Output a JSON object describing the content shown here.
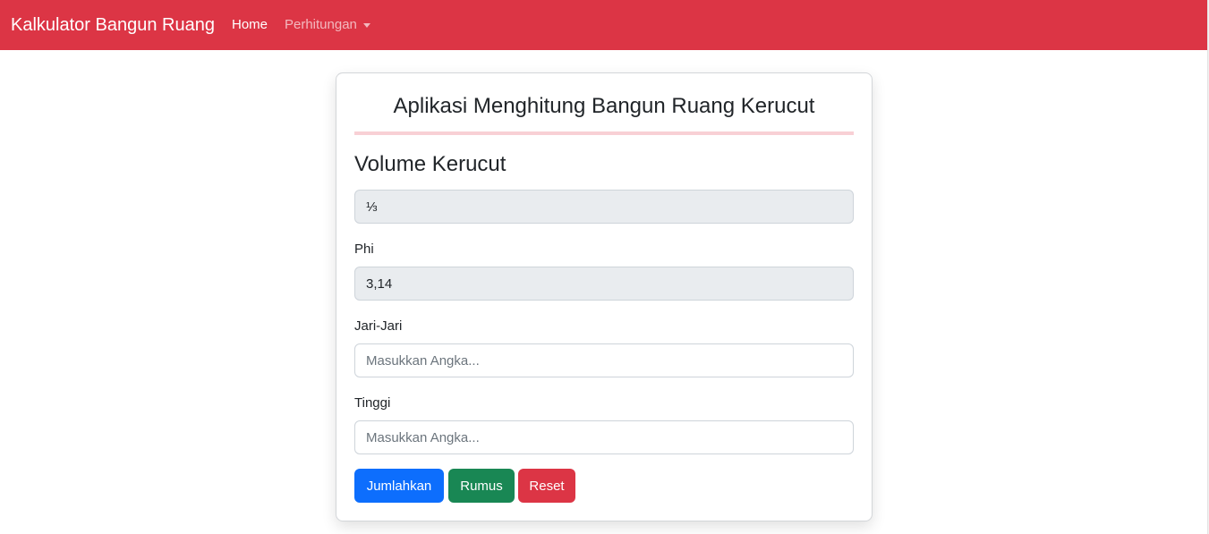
{
  "navbar": {
    "brand": "Kalkulator Bangun Ruang",
    "home": "Home",
    "dropdown": "Perhitungan",
    "background": "#dc3545"
  },
  "card": {
    "title": "Aplikasi Menghitung Bangun Ruang Kerucut",
    "subtitle": "Volume Kerucut",
    "fraction_field": {
      "value": "⅓"
    },
    "phi": {
      "label": "Phi",
      "value": "3,14"
    },
    "radius": {
      "label": "Jari-Jari",
      "placeholder": "Masukkan Angka..."
    },
    "height": {
      "label": "Tinggi",
      "placeholder": "Masukkan Angka..."
    },
    "buttons": {
      "sum": "Jumlahkan",
      "formula": "Rumus",
      "reset": "Reset"
    }
  },
  "colors": {
    "primary": "#0d6efd",
    "success": "#198754",
    "danger": "#dc3545"
  }
}
